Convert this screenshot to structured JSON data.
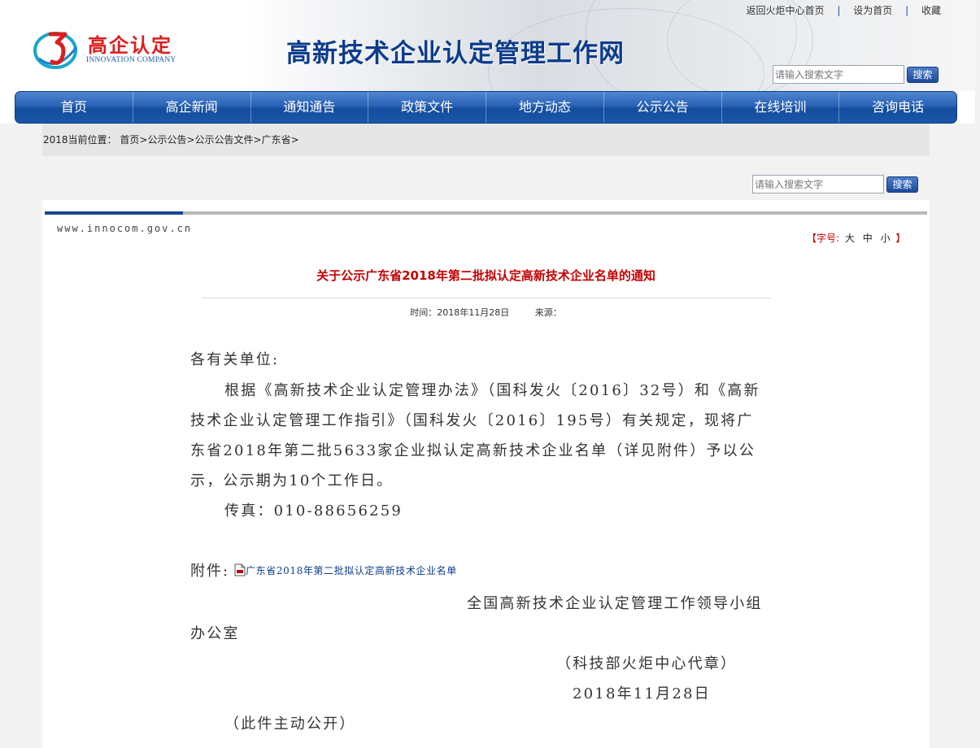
{
  "header": {
    "logo_cn": "高企认定",
    "logo_en": "INNOVATION COMPANY",
    "site_title": "高新技术企业认定管理工作网",
    "top_links": [
      "返回火炬中心首页",
      "设为首页",
      "收藏"
    ],
    "search_placeholder": "请输入搜索文字",
    "search_button": "搜索"
  },
  "nav": {
    "items": [
      "首页",
      "高企新闻",
      "通知通告",
      "政策文件",
      "地方动态",
      "公示公告",
      "在线培训",
      "咨询电话"
    ]
  },
  "breadcrumb": {
    "prefix": "2018当前位置：",
    "items": [
      "首页",
      "公示公告",
      "公示公告文件",
      "广东省"
    ],
    "separator": ">"
  },
  "content_search": {
    "placeholder": "请输入搜索文字",
    "button": "搜索"
  },
  "article": {
    "site_url": "www.innocom.gov.cn",
    "font_size_label_open": "【字号:",
    "font_size_options": [
      "大",
      "中",
      "小"
    ],
    "font_size_label_close": "】",
    "title": "关于公示广东省2018年第二批拟认定高新技术企业名单的通知",
    "time_label": "时间：2018年11月28日",
    "source_label": "来源：",
    "salutation": "各有关单位:",
    "paragraph_lines": [
      "根据《高新技术企业认定管理办法》（国科发火〔2016〕32号）和《高新",
      "技术企业认定管理工作指引》（国科发火〔2016〕195号）有关规定，现将广",
      "东省2018年第二批5633家企业拟认定高新技术企业名单（详见附件）予以公",
      "示，公示期为10个工作日。"
    ],
    "fax": "传真：010-88656259",
    "attachment_label": "附件:",
    "attachment_link": "广东省2018年第二批拟认定高新技术企业名单",
    "signature_line1": "全国高新技术企业认定管理工作领导小组",
    "signature_line2": "办公室",
    "seal": "（科技部火炬中心代章）",
    "date": "2018年11月28日",
    "note": "（此件主动公开）"
  },
  "colors": {
    "nav_blue": "#1a56a8",
    "title_red": "#c40000",
    "site_title_blue": "#0d3c8c",
    "logo_red": "#d8201e"
  }
}
